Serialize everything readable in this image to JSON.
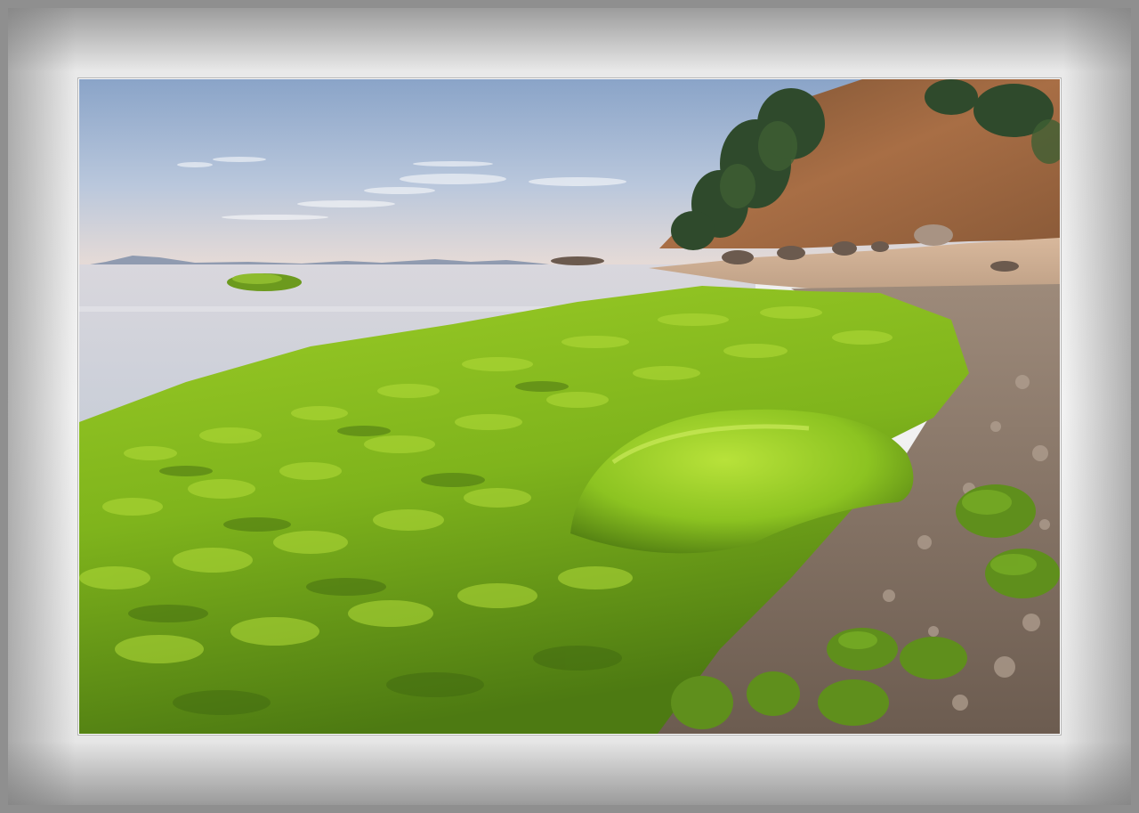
{
  "scene": {
    "subject": "coastal-shoreline-with-seaweed",
    "colors": {
      "frame_outer": "#8f8f8f",
      "frame_inner": "#f2f2f2",
      "sky_top": "#8aa4c8",
      "sky_horizon": "#e9dcd6",
      "sea": "#d4d6df",
      "seaweed_light": "#a8d62c",
      "seaweed_dark": "#4f7a10",
      "hill_brown": "#9a6440",
      "trees": "#2f4a2c",
      "sand": "#c8a98e"
    }
  }
}
